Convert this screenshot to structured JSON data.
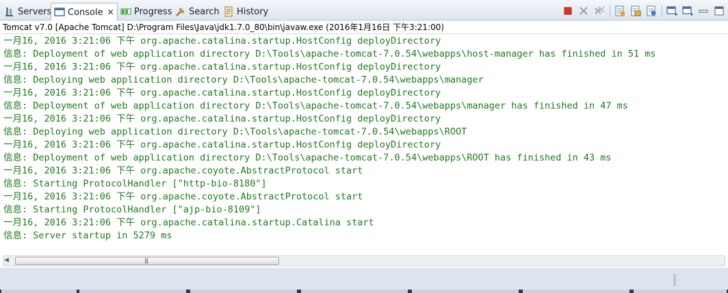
{
  "tabs": [
    {
      "label": "Servers",
      "icon": "servers-icon"
    },
    {
      "label": "Console",
      "icon": "console-icon",
      "close": "✕"
    },
    {
      "label": "Progress",
      "icon": "progress-icon"
    },
    {
      "label": "Search",
      "icon": "search-icon"
    },
    {
      "label": "History",
      "icon": "history-icon"
    }
  ],
  "toolbar": {
    "icons": [
      "terminate-icon",
      "remove-launch-icon",
      "remove-all-terminated-icon",
      "clear-console-icon",
      "scroll-lock-icon",
      "pin-console-icon",
      "display-selected-console-icon",
      "open-console-icon",
      "minimize-icon",
      "maximize-icon"
    ]
  },
  "console": {
    "description": "Tomcat v7.0 [Apache Tomcat] D:\\Program Files\\Java\\jdk1.7.0_80\\bin\\javaw.exe (2016年1月16日 下午3:21:00)",
    "lines": [
      "一月16, 2016 3:21:06 下午 org.apache.catalina.startup.HostConfig deployDirectory",
      "信息: Deployment of web application directory D:\\Tools\\apache-tomcat-7.0.54\\webapps\\host-manager has finished in 51 ms",
      "一月16, 2016 3:21:06 下午 org.apache.catalina.startup.HostConfig deployDirectory",
      "信息: Deploying web application directory D:\\Tools\\apache-tomcat-7.0.54\\webapps\\manager",
      "一月16, 2016 3:21:06 下午 org.apache.catalina.startup.HostConfig deployDirectory",
      "信息: Deployment of web application directory D:\\Tools\\apache-tomcat-7.0.54\\webapps\\manager has finished in 47 ms",
      "一月16, 2016 3:21:06 下午 org.apache.catalina.startup.HostConfig deployDirectory",
      "信息: Deploying web application directory D:\\Tools\\apache-tomcat-7.0.54\\webapps\\ROOT",
      "一月16, 2016 3:21:06 下午 org.apache.catalina.startup.HostConfig deployDirectory",
      "信息: Deployment of web application directory D:\\Tools\\apache-tomcat-7.0.54\\webapps\\ROOT has finished in 43 ms",
      "一月16, 2016 3:21:06 下午 org.apache.coyote.AbstractProtocol start",
      "信息: Starting ProtocolHandler [\"http-bio-8180\"]",
      "一月16, 2016 3:21:06 下午 org.apache.coyote.AbstractProtocol start",
      "信息: Starting ProtocolHandler [\"ajp-bio-8109\"]",
      "一月16, 2016 3:21:06 下午 org.apache.catalina.startup.Catalina start",
      "信息: Server startup in 5279 ms"
    ]
  },
  "scrollbar": {
    "grip": "|||"
  },
  "colors": {
    "console_text": "#1f7a1f",
    "terminate": "#d9342b",
    "tab_bar": "#dde5ef"
  }
}
